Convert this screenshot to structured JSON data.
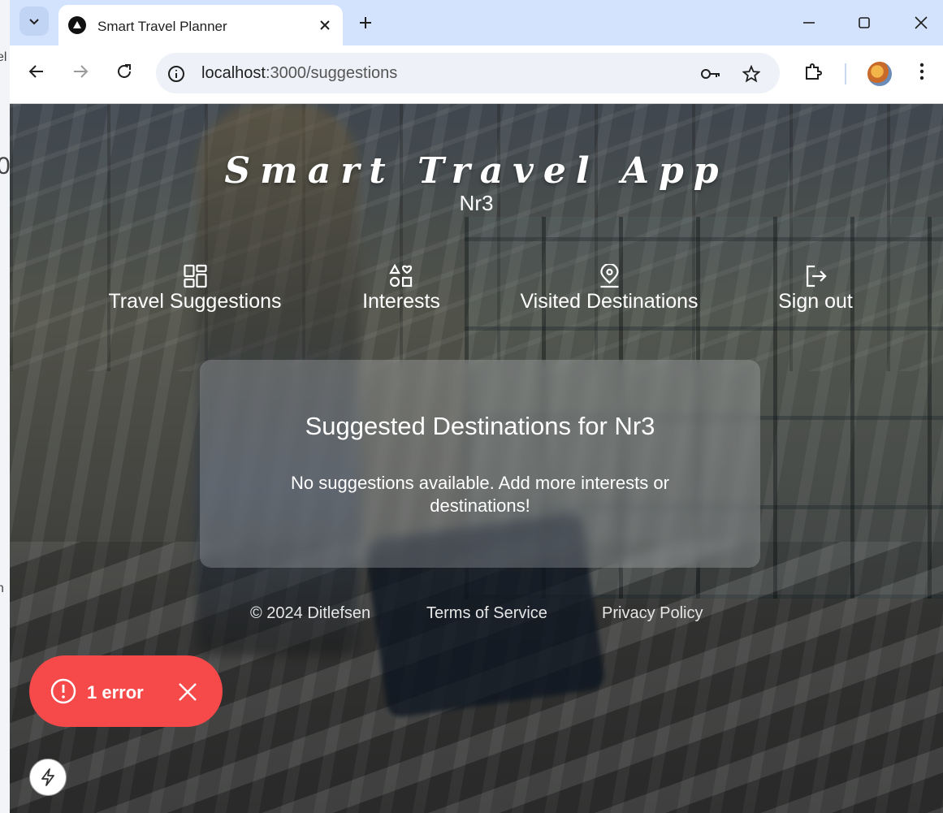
{
  "browser": {
    "tab_title": "Smart Travel Planner",
    "url_host": "localhost",
    "url_path": ":3000/suggestions"
  },
  "app": {
    "brand_title": "Smart Travel App",
    "brand_user": "Nr3",
    "nav": [
      {
        "label": "Travel Suggestions",
        "icon": "dashboard-icon"
      },
      {
        "label": "Interests",
        "icon": "shapes-heart-icon"
      },
      {
        "label": "Visited Destinations",
        "icon": "map-pin-icon"
      },
      {
        "label": "Sign out",
        "icon": "sign-out-icon"
      }
    ],
    "panel_title": "Suggested Destinations for Nr3",
    "panel_message": "No suggestions available. Add more interests or destinations!",
    "footer": {
      "copyright": "© 2024 Ditlefsen",
      "terms": "Terms of Service",
      "privacy": "Privacy Policy"
    }
  },
  "dev_overlay": {
    "error_label": "1 error"
  },
  "colors": {
    "tabbar": "#d3e3fd",
    "error": "#f64a4a"
  }
}
